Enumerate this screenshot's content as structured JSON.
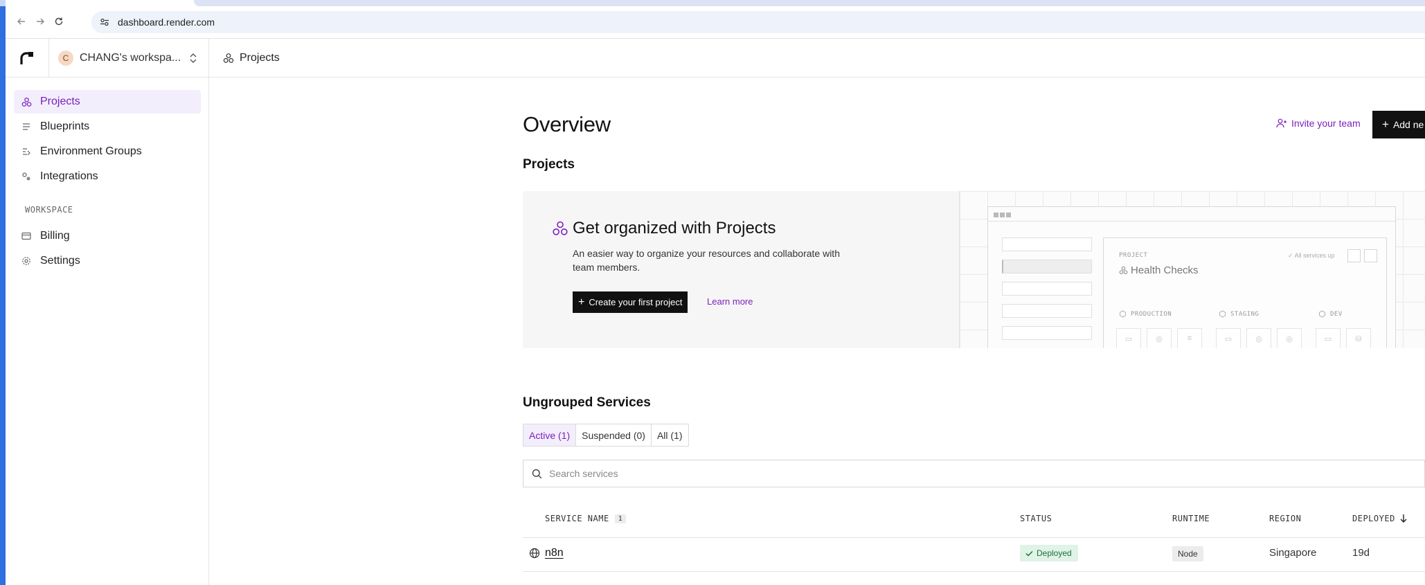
{
  "browser": {
    "url": "dashboard.render.com"
  },
  "sidebar": {
    "workspace": {
      "avatar_letter": "C",
      "name": "CHANG's workspa..."
    },
    "nav": [
      {
        "label": "Projects",
        "icon": "projects-icon",
        "active": true
      },
      {
        "label": "Blueprints",
        "icon": "blueprints-icon",
        "active": false
      },
      {
        "label": "Environment Groups",
        "icon": "environment-groups-icon",
        "active": false
      },
      {
        "label": "Integrations",
        "icon": "integrations-icon",
        "active": false
      }
    ],
    "section_label": "WORKSPACE",
    "workspace_nav": [
      {
        "label": "Billing",
        "icon": "billing-icon"
      },
      {
        "label": "Settings",
        "icon": "settings-icon"
      }
    ]
  },
  "header": {
    "breadcrumb": "Projects"
  },
  "main": {
    "title": "Overview",
    "invite_label": "Invite your team",
    "add_new_label": "Add ne",
    "projects_heading": "Projects",
    "promo": {
      "title": "Get organized with Projects",
      "description": "An easier way to organize your resources and collaborate with team members.",
      "cta_label": "Create your first project",
      "learn_more_label": "Learn more",
      "mock": {
        "project_label": "PROJECT",
        "project_title": "Health Checks",
        "all_up_label": "All services up",
        "environments": [
          "PRODUCTION",
          "STAGING",
          "DEV"
        ]
      }
    },
    "ungrouped_heading": "Ungrouped Services",
    "filters": [
      {
        "label": "Active (1)",
        "active": true
      },
      {
        "label": "Suspended (0)",
        "active": false
      },
      {
        "label": "All (1)",
        "active": false
      }
    ],
    "search_placeholder": "Search services",
    "table": {
      "columns": {
        "service_name": "SERVICE NAME",
        "service_count": "1",
        "status": "STATUS",
        "runtime": "RUNTIME",
        "region": "REGION",
        "deployed": "DEPLOYED"
      },
      "rows": [
        {
          "name": "n8n",
          "status": "Deployed",
          "runtime": "Node",
          "region": "Singapore",
          "deployed": "19d"
        }
      ]
    }
  },
  "colors": {
    "accent": "#7b1fbf",
    "status_success_bg": "#dff3e6",
    "status_success_fg": "#1e6f3d"
  }
}
